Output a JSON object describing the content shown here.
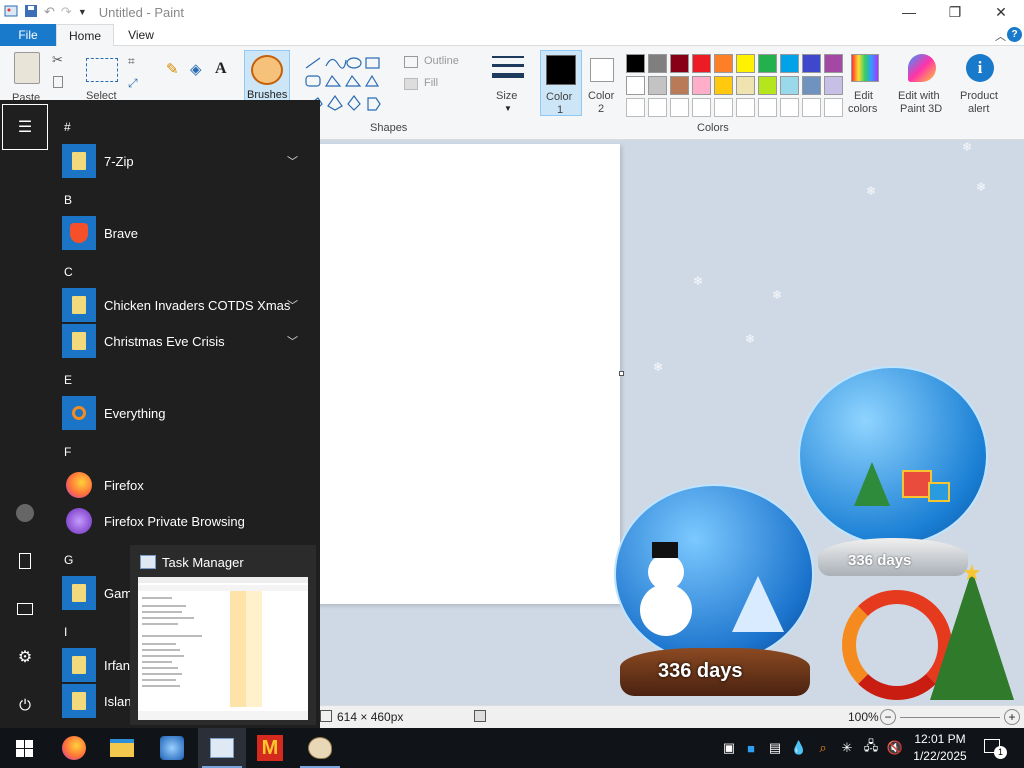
{
  "window": {
    "title": "Untitled - Paint",
    "controls": {
      "minimize": "—",
      "maximize": "❐",
      "close": "✕"
    }
  },
  "tabs": {
    "file": "File",
    "home": "Home",
    "view": "View"
  },
  "ribbon": {
    "clipboard": {
      "paste": "Paste"
    },
    "image": {
      "select": "Select"
    },
    "tools": {
      "brushes": "Brushes"
    },
    "shapes": {
      "group_label": "Shapes",
      "outline": "Outline",
      "fill": "Fill"
    },
    "size": "Size",
    "color1": "Color\n1",
    "color1_line1": "Color",
    "color1_line2": "1",
    "color2_line1": "Color",
    "color2_line2": "2",
    "colors_label": "Colors",
    "edit_colors_line1": "Edit",
    "edit_colors_line2": "colors",
    "paint3d_line1": "Edit with",
    "paint3d_line2": "Paint 3D",
    "product_alert_line1": "Product",
    "product_alert_line2": "alert",
    "palette_row1": [
      "#000000",
      "#7f7f7f",
      "#880015",
      "#ed1c24",
      "#ff7f27",
      "#fff200",
      "#22b14c",
      "#00a2e8",
      "#3f48cc",
      "#a349a4"
    ],
    "palette_row2": [
      "#ffffff",
      "#c3c3c3",
      "#b97a57",
      "#ffaec9",
      "#ffc90e",
      "#efe4b0",
      "#b5e61d",
      "#99d9ea",
      "#7092be",
      "#c8bfe7"
    ]
  },
  "status": {
    "dimensions": "614 × 460px",
    "zoom": "100%"
  },
  "start_menu": {
    "sections": [
      {
        "letter": "#",
        "items": [
          {
            "name": "7-Zip",
            "icon": "folder-icon",
            "expand": true
          }
        ]
      },
      {
        "letter": "B",
        "items": [
          {
            "name": "Brave",
            "icon": "brave-icon",
            "expand": false
          }
        ]
      },
      {
        "letter": "C",
        "items": [
          {
            "name": "Chicken Invaders COTDS Xmas",
            "icon": "folder-icon",
            "expand": true
          },
          {
            "name": "Christmas Eve Crisis",
            "icon": "folder-icon",
            "expand": true
          }
        ]
      },
      {
        "letter": "E",
        "items": [
          {
            "name": "Everything",
            "icon": "search-icon",
            "expand": false
          }
        ]
      },
      {
        "letter": "F",
        "items": [
          {
            "name": "Firefox",
            "icon": "firefox-icon",
            "expand": false
          },
          {
            "name": "Firefox Private Browsing",
            "icon": "private-browsing-icon",
            "expand": false
          }
        ]
      },
      {
        "letter": "G",
        "items": [
          {
            "name": "Game",
            "icon": "folder-icon",
            "expand": false
          }
        ]
      },
      {
        "letter": "I",
        "items": [
          {
            "name": "IrfanV",
            "icon": "folder-icon",
            "expand": false
          },
          {
            "name": "Island",
            "icon": "folder-icon",
            "expand": false
          }
        ]
      }
    ]
  },
  "task_preview": {
    "title": "Task Manager"
  },
  "clock": {
    "time": "12:01 PM",
    "date": "1/22/2025"
  },
  "notifications": {
    "count": "1"
  },
  "wallpaper": {
    "globe_text": "336 days"
  }
}
